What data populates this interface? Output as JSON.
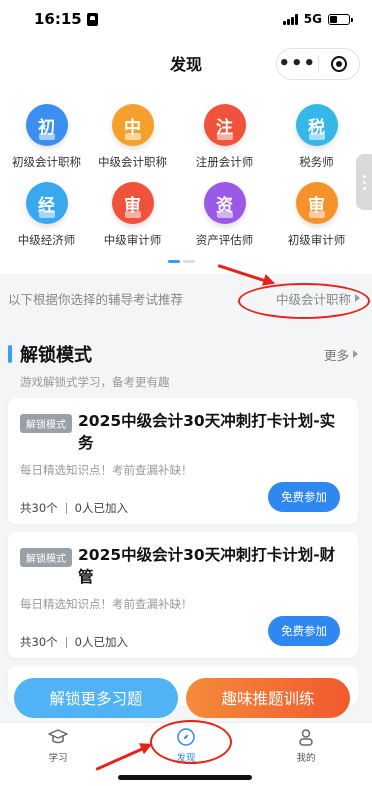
{
  "status": {
    "time": "16:15",
    "network": "5G"
  },
  "nav": {
    "title": "发现"
  },
  "categories": [
    {
      "char": "初",
      "label": "初级会计职称",
      "color": "#3a8ff0"
    },
    {
      "char": "中",
      "label": "中级会计职称",
      "color": "#f5a02a"
    },
    {
      "char": "注",
      "label": "注册会计师",
      "color": "#f0523c"
    },
    {
      "char": "税",
      "label": "税务师",
      "color": "#35b8e8"
    },
    {
      "char": "经",
      "label": "中级经济师",
      "color": "#39a8ee"
    },
    {
      "char": "审",
      "label": "中级审计师",
      "color": "#f0523c"
    },
    {
      "char": "资",
      "label": "资产评估师",
      "color": "#9b59e8"
    },
    {
      "char": "审",
      "label": "初级审计师",
      "color": "#f5932a"
    }
  ],
  "recommend": {
    "text": "以下根据你选择的辅导考试推荐",
    "selected": "中级会计职称"
  },
  "section": {
    "title": "解锁模式",
    "more": "更多",
    "subtitle": "游戏解锁式学习，备考更有趣"
  },
  "cards": [
    {
      "tag": "解锁模式",
      "title": "2025中级会计30天冲刺打卡计划-实务",
      "desc": "每日精选知识点！考前查漏补缺！",
      "count": "共30个",
      "joined": "0人已加入",
      "button": "免费参加"
    },
    {
      "tag": "解锁模式",
      "title": "2025中级会计30天冲刺打卡计划-财管",
      "desc": "每日精选知识点！考前查漏补缺！",
      "count": "共30个",
      "joined": "0人已加入",
      "button": "免费参加"
    }
  ],
  "actions": {
    "unlock": "解锁更多习题",
    "fun": "趣味推题训练"
  },
  "tabs": [
    {
      "label": "学习",
      "icon": "graduation-cap-icon"
    },
    {
      "label": "发现",
      "icon": "compass-icon"
    },
    {
      "label": "我的",
      "icon": "user-icon"
    }
  ],
  "colors": {
    "accent": "#2f87f0",
    "annotation": "#e5231a"
  }
}
